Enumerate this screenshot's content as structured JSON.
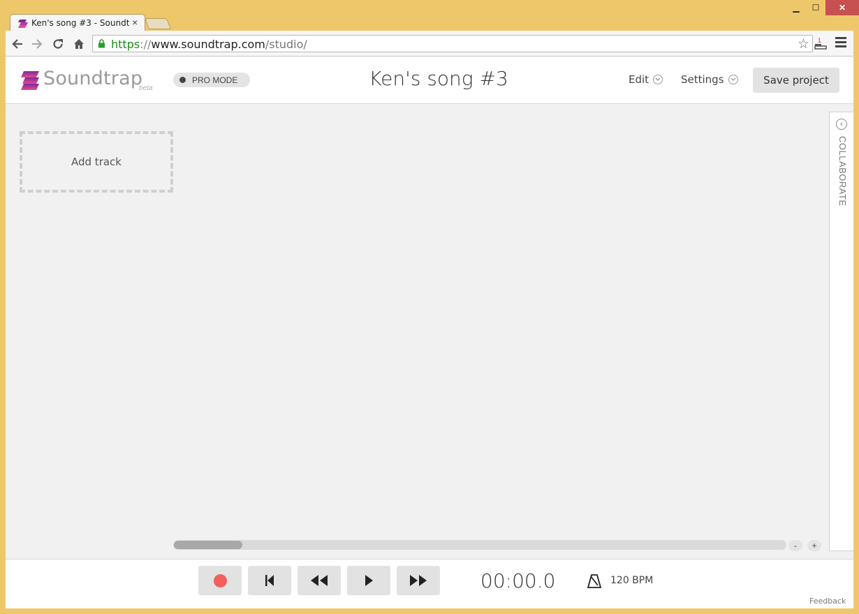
{
  "browser": {
    "tab_title": "Ken's song #3 - Soundt",
    "tab_close": "×",
    "url_scheme": "https",
    "url_sep": "://",
    "url_host": "www.soundtrap.com",
    "url_path": "/studio/",
    "extension_badge": "1",
    "window_controls": {
      "minimize": "▁",
      "maximize": "☐",
      "close": "✕"
    }
  },
  "header": {
    "brand": "Soundtrap",
    "beta": "beta",
    "pro_mode_label": "PRO MODE",
    "song_title": "Ken's song #3",
    "edit_label": "Edit",
    "settings_label": "Settings",
    "save_label": "Save project"
  },
  "workspace": {
    "add_track_label": "Add track",
    "collaborate_label": "COLLABORATE",
    "zoom_out_label": "-",
    "zoom_in_label": "+"
  },
  "transport": {
    "time": "00:00.0",
    "bpm": "120 BPM",
    "feedback": "Feedback"
  },
  "colors": {
    "window_frame": "#efc76b",
    "record": "#f25f5c",
    "brand_gradient_top": "#7b2a9e",
    "brand_gradient_bottom": "#e64b8c"
  }
}
